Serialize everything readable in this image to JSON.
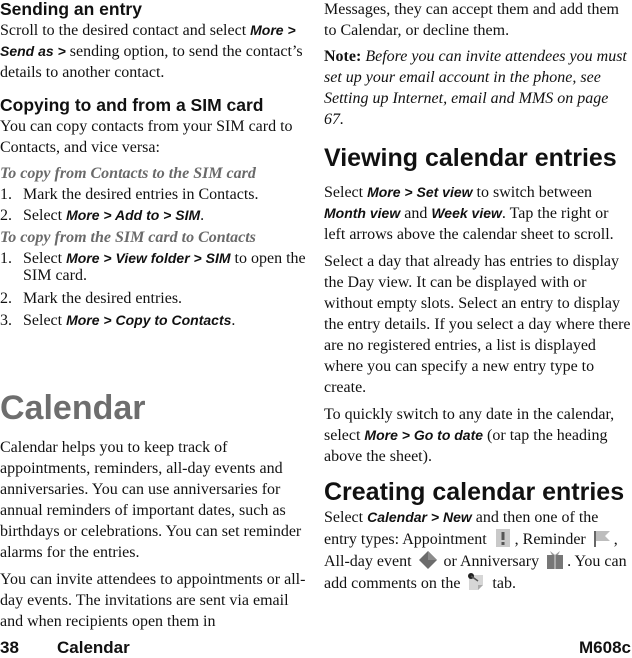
{
  "left": {
    "sending_heading": "Sending an entry",
    "sending_p": {
      "t1": "Scroll to the desired contact and select ",
      "b1": "More > Send as >",
      "t2": " sending option, to send the contact’s details to another contact."
    },
    "copying_heading": "Copying to and from a SIM card",
    "copying_p": "You can copy contacts from your SIM card to Contacts, and vice versa:",
    "sub1": "To copy from Contacts to the SIM card",
    "list1": [
      {
        "num": "1.",
        "text": "Mark the desired entries in Contacts.",
        "bold": "",
        "after": ""
      },
      {
        "num": "2.",
        "text": "Select ",
        "bold": "More > Add to > SIM",
        "after": "."
      }
    ],
    "sub2": "To copy from the SIM card to Contacts",
    "list2": [
      {
        "num": "1.",
        "text": "Select ",
        "bold": "More > View folder > SIM",
        "after": " to open the SIM card."
      },
      {
        "num": "2.",
        "text": "Mark the desired entries.",
        "bold": "",
        "after": ""
      },
      {
        "num": "3.",
        "text": "Select ",
        "bold": "More > Copy to Contacts",
        "after": "."
      }
    ],
    "chapter_title": "Calendar",
    "cal_p1": "Calendar helps you to keep track of appointments, reminders, all-day events and anniversaries. You can use anniversaries for annual reminders of important dates, such as birthdays or celebrations. You can set reminder alarms for the entries.",
    "cal_p2": "You can invite attendees to appointments or all-day events. The invitations are sent via email and when recipients open them in"
  },
  "right": {
    "cont_p": "Messages, they can accept them and add them to Calendar, or decline them.",
    "note_label": "Note:",
    "note_text": " Before you can invite attendees you must set up your email account in the phone, see Setting up Internet, email and MMS on page 67.",
    "viewing_heading": "Viewing calendar entries",
    "view_p1": {
      "t1": "Select ",
      "b1": "More > Set view",
      "t2": " to switch between ",
      "b2": "Month view",
      "t3": " and ",
      "b3": "Week view",
      "t4": ". Tap the right or left arrows above the calendar sheet to scroll."
    },
    "view_p2": "Select a day that already has entries to display the Day view. It can be displayed with or without empty slots. Select an entry to display the entry details. If you select a day where there are no registered entries, a list is displayed where you can specify a new entry type to create.",
    "view_p3": {
      "t1": "To quickly switch to any date in the calendar, select ",
      "b1": "More > Go to date",
      "t2": " (or tap the heading above the sheet)."
    },
    "creating_heading": "Creating calendar entries",
    "create_p": {
      "t1": "Select ",
      "b1": "Calendar > New",
      "t2": " and then one of the entry types: Appointment ",
      "t3": ", Reminder ",
      "t4": ", All-day event ",
      "t5": " or Anniversary ",
      "t6": ". You can add comments on the ",
      "t7": " tab."
    },
    "icons": [
      "appointment-icon",
      "reminder-flag-icon",
      "all-day-event-diamond-icon",
      "anniversary-gift-icon",
      "comments-note-icon"
    ]
  },
  "footer": {
    "page_number": "38",
    "section": "Calendar",
    "model": "M608c"
  }
}
